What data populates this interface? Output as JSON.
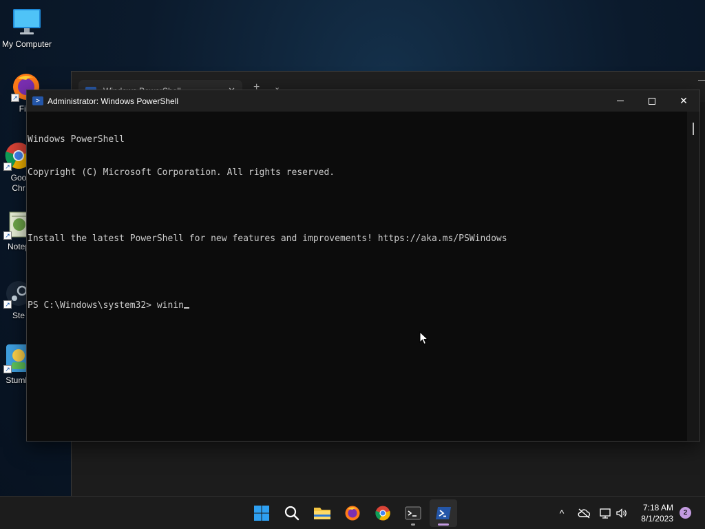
{
  "desktop": {
    "icons": [
      {
        "label": "My Computer",
        "icon": "monitor-icon"
      },
      {
        "label": "Fire",
        "icon": "firefox-icon"
      },
      {
        "label": "Goo\nChr",
        "icon": "chrome-icon"
      },
      {
        "label": "Notep",
        "icon": "notepad-icon"
      },
      {
        "label": "Ste",
        "icon": "steam-icon"
      },
      {
        "label": "Stumbl",
        "icon": "stumble-icon"
      }
    ]
  },
  "background_window": {
    "tab_title": "Windows PowerShell",
    "tab_close": "✕",
    "new_tab": "+",
    "dropdown": "⌄"
  },
  "powershell": {
    "title": "Administrator: Windows PowerShell",
    "controls": {
      "minimize": "minimize",
      "maximize": "maximize",
      "close": "✕"
    },
    "lines": [
      "Windows PowerShell",
      "Copyright (C) Microsoft Corporation. All rights reserved.",
      "",
      "Install the latest PowerShell for new features and improvements! https://aka.ms/PSWindows",
      ""
    ],
    "prompt": "PS C:\\Windows\\system32> ",
    "typed": "winin"
  },
  "taskbar": {
    "apps": [
      "start-icon",
      "search-icon",
      "file-explorer-icon",
      "firefox-icon",
      "chrome-icon",
      "terminal-icon",
      "powershell-icon"
    ],
    "tray": {
      "chevron": "^"
    },
    "clock": {
      "time": "7:18 AM",
      "date": "8/1/2023"
    },
    "notifications": "2"
  },
  "colors": {
    "accent": "#c39be0",
    "console_text": "#cccccc",
    "console_bg": "#0c0c0c"
  }
}
